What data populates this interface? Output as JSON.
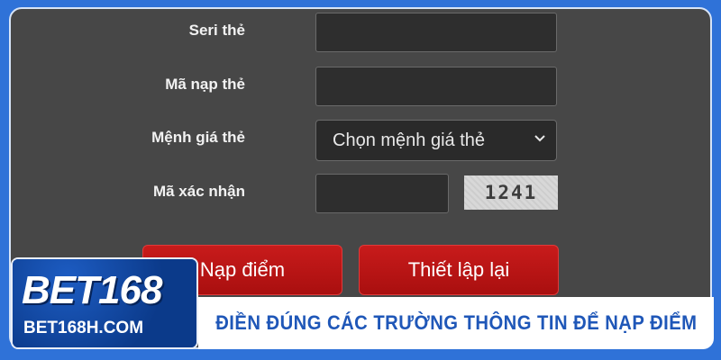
{
  "form": {
    "rows": [
      {
        "label": "Seri thẻ",
        "value": ""
      },
      {
        "label": "Mã nạp thẻ",
        "value": ""
      },
      {
        "label": "Mệnh giá thẻ",
        "selected": "Chọn mệnh giá thẻ"
      },
      {
        "label": "Mã xác nhận",
        "value": "",
        "captcha": "1241"
      }
    ],
    "submit_label": "Nạp điểm",
    "reset_label": "Thiết lập lại"
  },
  "brand": {
    "logo_text": "BET168",
    "domain": "BET168H.COM"
  },
  "caption": "ĐIỀN ĐÚNG CÁC TRƯỜNG THÔNG TIN ĐỂ NẠP ĐIỂM",
  "colors": {
    "panel": "#474747",
    "button": "#c81b1b",
    "frame": "#2f72d8",
    "caption_text": "#1f57b8"
  }
}
